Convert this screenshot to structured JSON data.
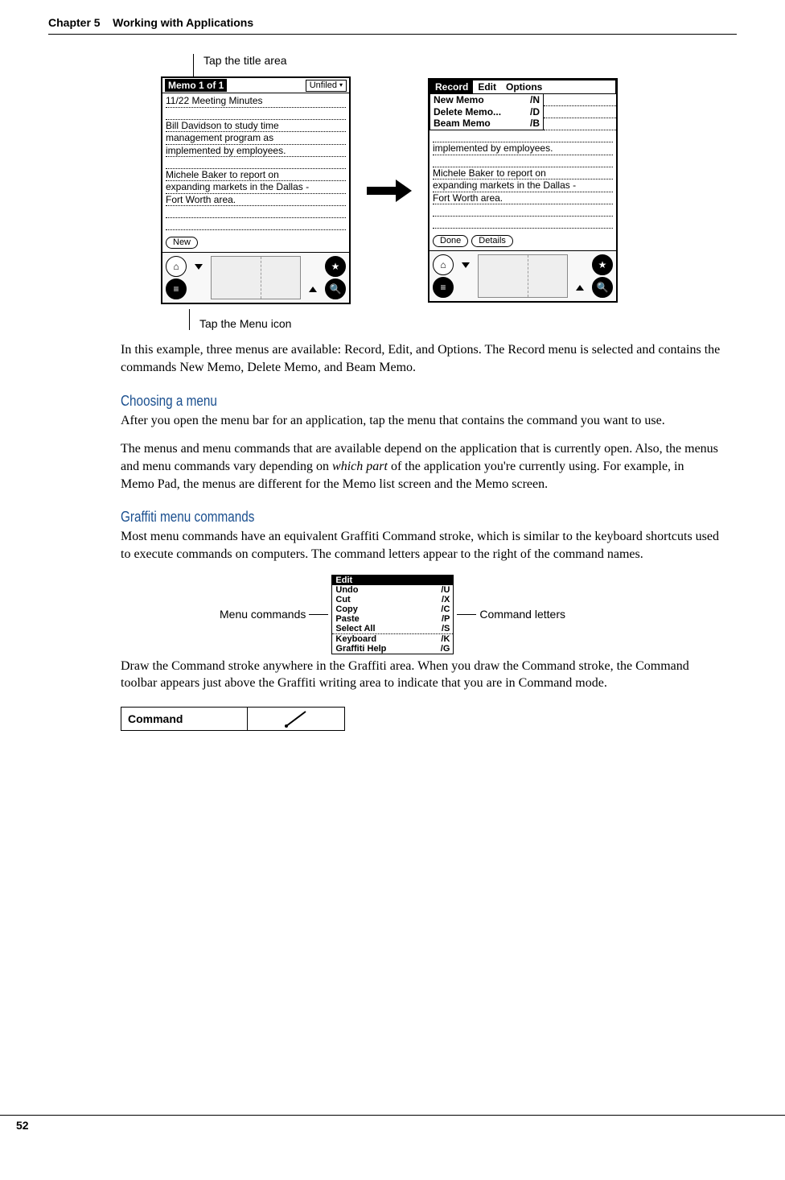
{
  "header": {
    "chapter": "Chapter 5",
    "title": "Working with Applications"
  },
  "footer": {
    "page_number": "52"
  },
  "callouts": {
    "tap_title": "Tap the title area",
    "tap_menu_icon": "Tap the Menu icon"
  },
  "palm_left": {
    "title": "Memo 1 of 1",
    "category": "Unfiled",
    "lines": [
      "11/22 Meeting Minutes",
      "",
      "Bill Davidson to study time",
      "management program as",
      "implemented by employees.",
      "",
      "Michele Baker to report on",
      "expanding markets in the Dallas -",
      "Fort Worth area.",
      "",
      ""
    ],
    "buttons": {
      "new": "New"
    }
  },
  "palm_right": {
    "menubar": [
      "Record",
      "Edit",
      "Options"
    ],
    "menu_items": [
      {
        "label": "New Memo",
        "shortcut": "/N"
      },
      {
        "label": "Delete Memo...",
        "shortcut": "/D"
      },
      {
        "label": "Beam Memo",
        "shortcut": "/B"
      }
    ],
    "lines": [
      "implemented by employees.",
      "",
      "Michele Baker to report on",
      "expanding markets in the Dallas -",
      "Fort Worth area.",
      "",
      ""
    ],
    "buttons": {
      "done": "Done",
      "details": "Details"
    }
  },
  "para1": "In this example, three menus are available: Record, Edit, and Options. The Record menu is selected and contains the commands New Memo, Delete Memo, and Beam Memo.",
  "sectionA": {
    "heading": "Choosing a menu",
    "p1": "After you open the menu bar for an application, tap the menu that contains the command you want to use.",
    "p2a": "The menus and menu commands that are available depend on the application that is currently open. Also, the menus and menu commands vary depending on ",
    "p2_italic": "which part",
    "p2b": " of the application you're currently using. For example, in Memo Pad, the menus are different for the Memo list screen and the Memo screen."
  },
  "sectionB": {
    "heading": "Graffiti menu commands",
    "p1": "Most menu commands have an equivalent Graffiti Command stroke, which is similar to the keyboard shortcuts used to execute commands on computers. The command letters appear to the right of the command names.",
    "labels": {
      "menu_commands": "Menu commands",
      "command_letters": "Command letters"
    },
    "edit_menu": {
      "title": "Edit",
      "items_a": [
        {
          "label": "Undo",
          "shortcut": "/U"
        },
        {
          "label": "Cut",
          "shortcut": "/X"
        },
        {
          "label": "Copy",
          "shortcut": "/C"
        },
        {
          "label": "Paste",
          "shortcut": "/P"
        },
        {
          "label": "Select All",
          "shortcut": "/S"
        }
      ],
      "items_b": [
        {
          "label": "Keyboard",
          "shortcut": "/K"
        },
        {
          "label": "Graffiti Help",
          "shortcut": "/G"
        }
      ]
    },
    "p2": "Draw the Command stroke anywhere in the Graffiti area. When you draw the Command stroke, the Command toolbar appears just above the Graffiti writing area to indicate that you are in Command mode."
  },
  "command_table": {
    "label": "Command"
  }
}
